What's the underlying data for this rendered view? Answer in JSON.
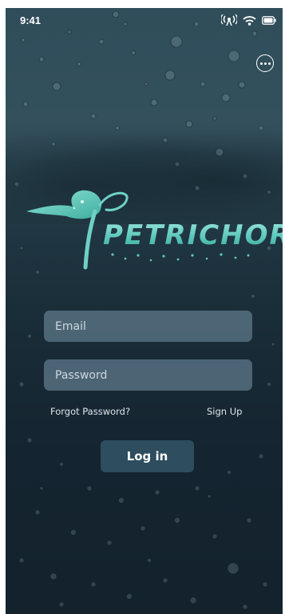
{
  "status_bar": {
    "time": "9:41",
    "icons": [
      "antenna-icon",
      "wifi-icon",
      "battery-icon"
    ]
  },
  "header": {
    "more_icon": "more-options-icon"
  },
  "brand": {
    "logo_text": "PETRICHOR",
    "accent_color": "#6fd0c6"
  },
  "form": {
    "email_placeholder": "Email",
    "password_placeholder": "Password",
    "forgot_password_label": "Forgot Password?",
    "sign_up_label": "Sign Up",
    "login_label": "Log in",
    "button_color": "#2e4d5e"
  }
}
